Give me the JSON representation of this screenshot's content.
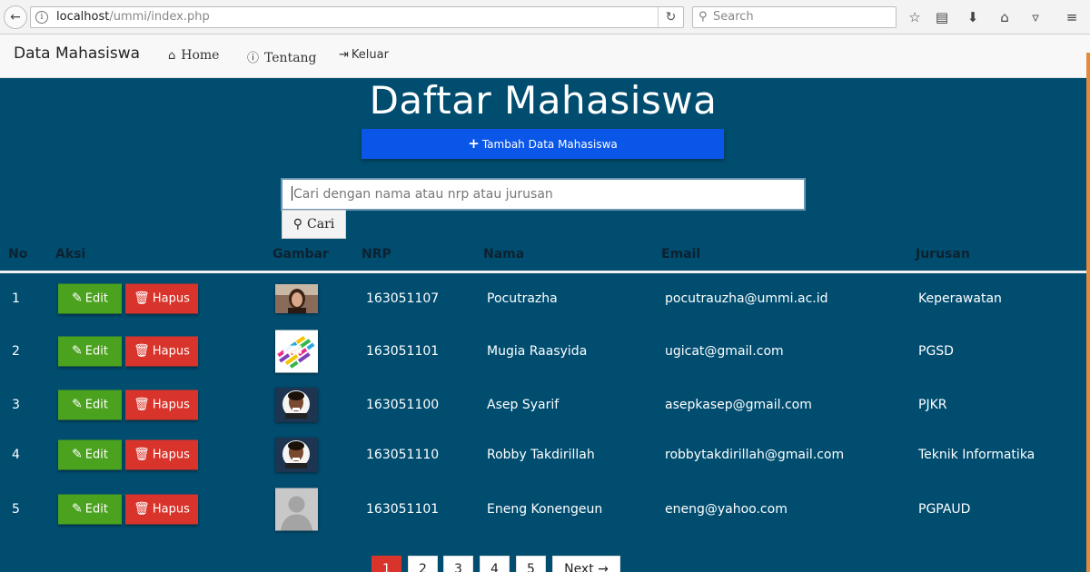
{
  "browser": {
    "url_host": "localhost",
    "url_path": "/ummi/index.php",
    "search_placeholder": "Search"
  },
  "nav": {
    "brand": "Data Mahasiswa",
    "home": "Home",
    "tentang": "Tentang",
    "keluar": "Keluar"
  },
  "page": {
    "title": "Daftar Mahasiswa",
    "add_button": "Tambah Data Mahasiswa",
    "search_placeholder": "Cari dengan nama atau nrp atau jurusan",
    "search_button": "Cari"
  },
  "table": {
    "headers": [
      "No",
      "Aksi",
      "Gambar",
      "NRP",
      "Nama",
      "Email",
      "Jurusan"
    ],
    "edit_label": "Edit",
    "hapus_label": "Hapus",
    "rows": [
      {
        "no": "1",
        "nrp": "163051107",
        "nama": "Pocutrazha",
        "email": "pocutrauzha@ummi.ac.id",
        "jurusan": "Keperawatan",
        "image": "woman-portrait"
      },
      {
        "no": "2",
        "nrp": "163051101",
        "nama": "Mugia Raasyida",
        "email": "ugicat@gmail.com",
        "jurusan": "PGSD",
        "image": "colorful-logo"
      },
      {
        "no": "3",
        "nrp": "163051100",
        "nama": "Asep Syarif",
        "email": "asepkasep@gmail.com",
        "jurusan": "PJKR",
        "image": "man-portrait"
      },
      {
        "no": "4",
        "nrp": "163051110",
        "nama": "Robby Takdirillah",
        "email": "robbytakdirillah@gmail.com",
        "jurusan": "Teknik Informatika",
        "image": "man-portrait"
      },
      {
        "no": "5",
        "nrp": "163051101",
        "nama": "Eneng Konengeun",
        "email": "eneng@yahoo.com",
        "jurusan": "PGPAUD",
        "image": "default-avatar"
      }
    ]
  },
  "pagination": {
    "pages": [
      "1",
      "2",
      "3",
      "4",
      "5"
    ],
    "active": "1",
    "next": "Next →"
  },
  "colors": {
    "background": "#004d70",
    "add_button": "#0a56e8",
    "edit_button": "#4ba21e",
    "hapus_button": "#d9342b"
  }
}
